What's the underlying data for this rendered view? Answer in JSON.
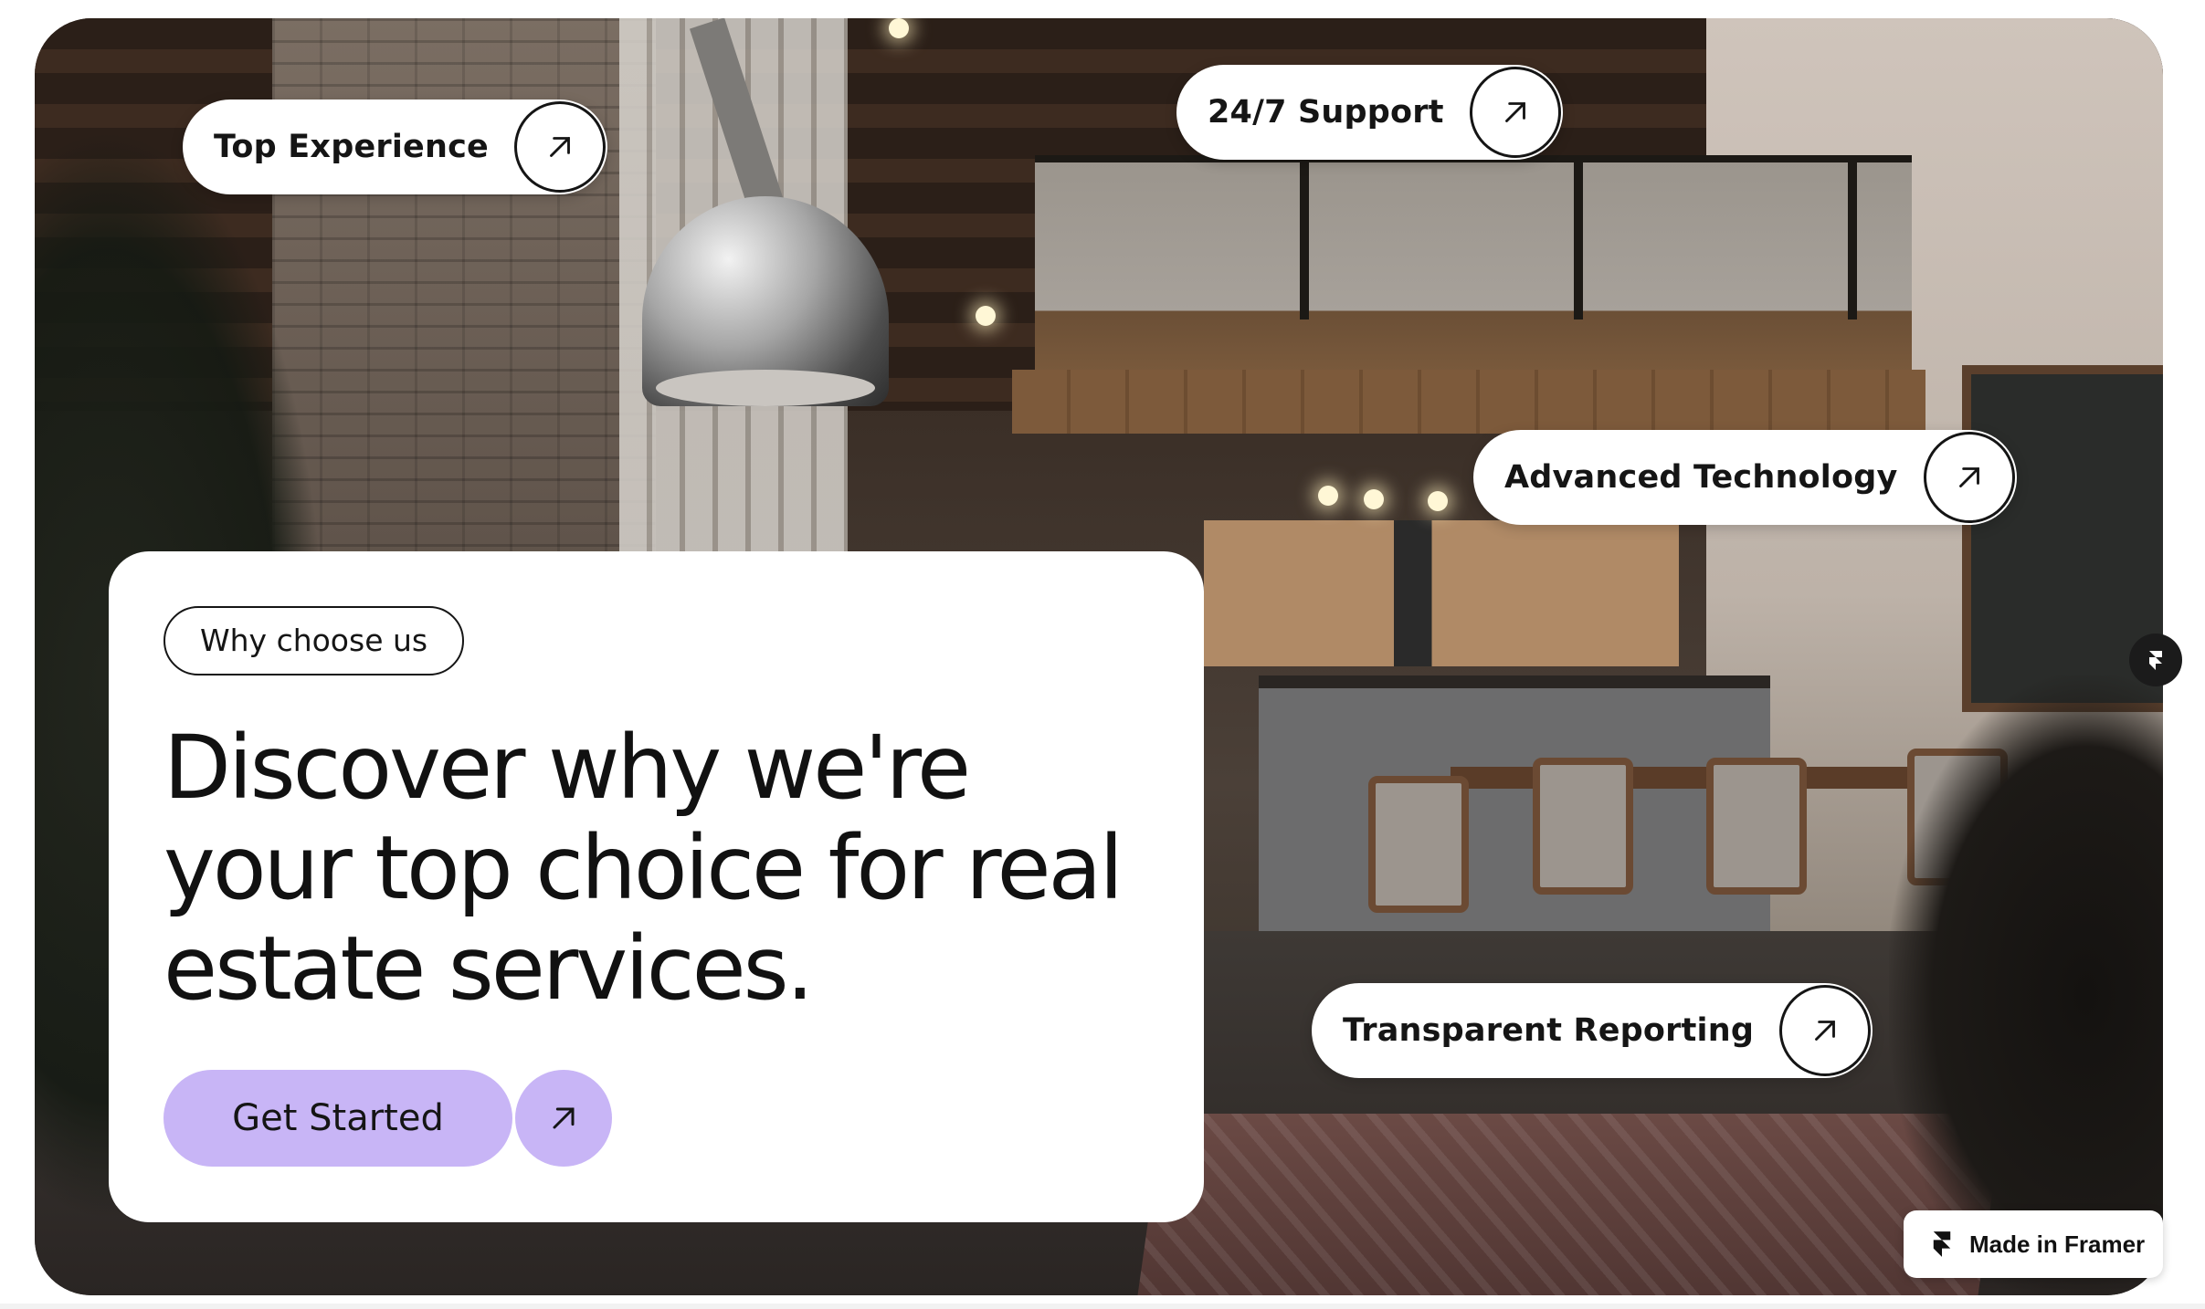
{
  "features": [
    {
      "label": "Top Experience",
      "icon": "arrow-up-right-icon"
    },
    {
      "label": "24/7 Support",
      "icon": "arrow-up-right-icon"
    },
    {
      "label": "Advanced Technology",
      "icon": "arrow-up-right-icon"
    },
    {
      "label": "Transparent Reporting",
      "icon": "arrow-up-right-icon"
    }
  ],
  "card": {
    "tag": "Why choose us",
    "headline": "Discover why we're your top choice for real estate services.",
    "cta_label": "Get Started",
    "cta_icon": "arrow-up-right-icon"
  },
  "badge": {
    "label": "Made in Framer",
    "icon": "framer-logo-icon"
  },
  "colors": {
    "accent": "#c8b5f6",
    "text": "#151515",
    "surface": "#ffffff"
  }
}
